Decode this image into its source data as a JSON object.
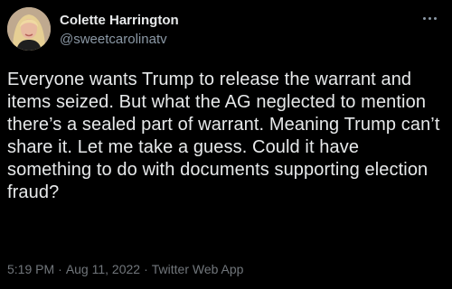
{
  "user": {
    "display_name": "Colette Harrington",
    "handle": "@sweetcarolinatv",
    "avatar_icon": "profile-photo"
  },
  "menu": {
    "icon": "more-horizontal-icon"
  },
  "tweet": {
    "text": "Everyone wants Trump to release the warrant and items seized. But what the AG neglected to mention there’s a sealed part of warrant. Meaning Trump can’t share it. Let me take a guess. Could it have something to do with documents supporting election fraud?"
  },
  "meta": {
    "time": "5:19 PM",
    "separator": "·",
    "date": "Aug 11, 2022",
    "source": "Twitter Web App"
  },
  "colors": {
    "background": "#000000",
    "primary_text": "#e7e9ea",
    "secondary_text": "#71767b"
  }
}
